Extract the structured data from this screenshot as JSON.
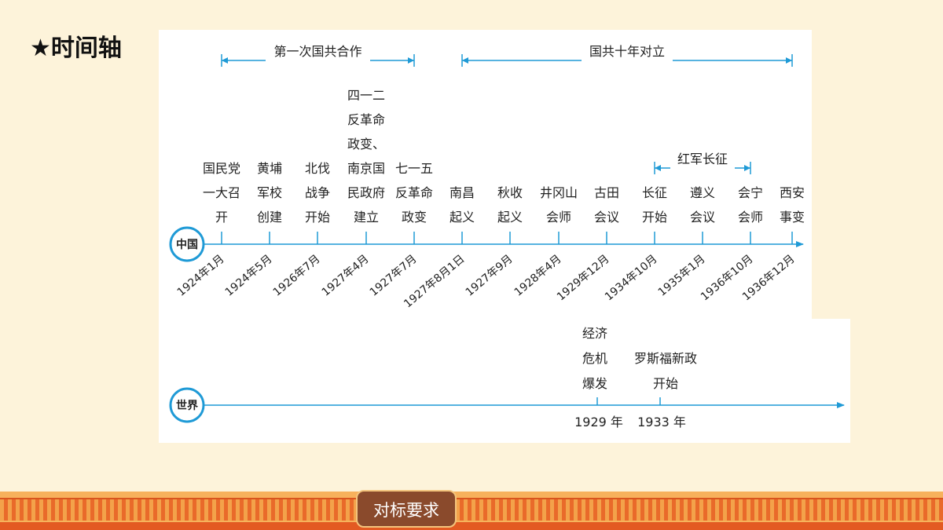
{
  "title": "★时间轴",
  "china": {
    "badge": "中国",
    "periods": [
      {
        "label": "第一次国共合作",
        "start": "1924年1月",
        "end": "1927年7月"
      },
      {
        "label": "国共十年对立",
        "start": "1927年8月1日",
        "end": "1936年12月"
      },
      {
        "label": "红军长征",
        "start": "1934年10月",
        "end": "1936年10月"
      }
    ],
    "events": [
      {
        "date": "1924年1月",
        "lines": [
          "国民党",
          "一大召",
          "开"
        ]
      },
      {
        "date": "1924年5月",
        "lines": [
          "黄埔",
          "军校",
          "创建"
        ]
      },
      {
        "date": "1926年7月",
        "lines": [
          "北伐",
          "战争",
          "开始"
        ]
      },
      {
        "date": "1927年4月",
        "lines": [
          "四一二",
          "反革命",
          "政变、",
          "南京国",
          "民政府",
          "建立"
        ]
      },
      {
        "date": "1927年7月",
        "lines": [
          "七一五",
          "反革命",
          "政变"
        ]
      },
      {
        "date": "1927年8月1日",
        "lines": [
          "南昌",
          "起义"
        ]
      },
      {
        "date": "1927年9月",
        "lines": [
          "秋收",
          "起义"
        ]
      },
      {
        "date": "1928年4月",
        "lines": [
          "井冈山",
          "会师"
        ]
      },
      {
        "date": "1929年12月",
        "lines": [
          "古田",
          "会议"
        ]
      },
      {
        "date": "1934年10月",
        "lines": [
          "长征",
          "开始"
        ]
      },
      {
        "date": "1935年1月",
        "lines": [
          "遵义",
          "会议"
        ]
      },
      {
        "date": "1936年10月",
        "lines": [
          "会宁",
          "会师"
        ]
      },
      {
        "date": "1936年12月",
        "lines": [
          "西安",
          "事变"
        ]
      }
    ]
  },
  "world": {
    "badge": "世界",
    "events": [
      {
        "date": "1929 年",
        "lines": [
          "经济",
          "危机",
          "爆发"
        ]
      },
      {
        "date": "1933 年",
        "lines": [
          "罗斯福新政",
          "开始"
        ]
      }
    ]
  },
  "footer": {
    "badge": "对标要求"
  },
  "colors": {
    "axis": "#1f9ad6",
    "badge_fill": "#ffffff"
  }
}
